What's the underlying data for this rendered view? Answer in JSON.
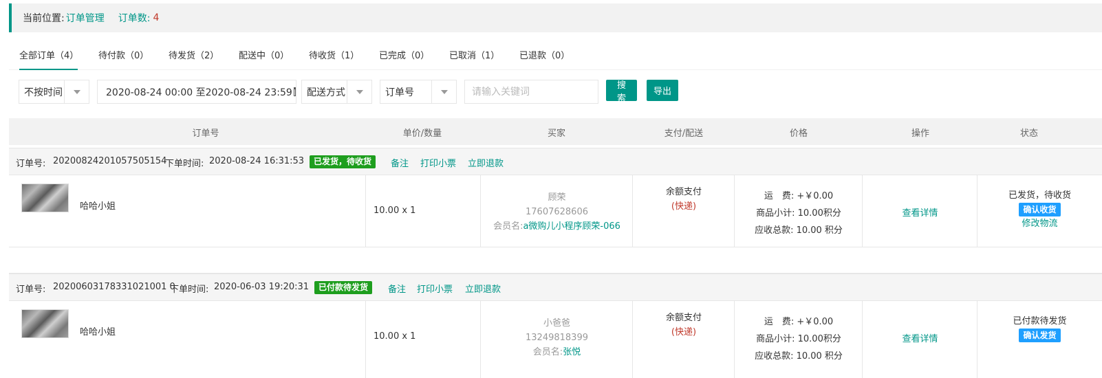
{
  "breadcrumb": {
    "label": "当前位置:",
    "current": "订单管理",
    "count_label": "订单数:",
    "count": "4"
  },
  "tabs": [
    {
      "label": "全部订单（4）"
    },
    {
      "label": "待付款（0）"
    },
    {
      "label": "待发货（2）"
    },
    {
      "label": "配送中（0）"
    },
    {
      "label": "待收货（1）"
    },
    {
      "label": "已完成（0）"
    },
    {
      "label": "已取消（1）"
    },
    {
      "label": "已退款（0）"
    }
  ],
  "filters": {
    "time_mode": "不按时间",
    "date_range": "2020-08-24 00:00 至2020-08-24 23:59",
    "delivery": "配送方式",
    "field": "订单号",
    "keyword_placeholder": "请输入关键词",
    "search_label": "搜索",
    "export_label": "导出"
  },
  "table_headers": [
    "订单号",
    "单价/数量",
    "买家",
    "支付/配送",
    "价格",
    "操作",
    "状态"
  ],
  "orders": [
    {
      "no_label": "订单号:",
      "no": "20200824201057505154",
      "time_label": "下单时间:",
      "time": "2020-08-24  16:31:53",
      "badge": "已发货，待收货",
      "link_note": "备注",
      "link_print": "打印小票",
      "link_refund": "立即退款",
      "product": "哈哈小姐",
      "price_qty": "10.00 x 1",
      "buyer_name": "顾荣",
      "buyer_phone": "17607628606",
      "member_label": "会员名:",
      "member": "a微购儿小程序顾荣-066",
      "pay": "余额支付",
      "delivery": "(快递)",
      "freight": "运　费: +￥0.00",
      "subtotal": "商品小计: 10.00积分",
      "total": "应收总款: 10.00 积分",
      "detail": "查看详情",
      "status": "已发货，待收货",
      "status_btn": "确认收货",
      "status_link": "修改物流"
    },
    {
      "no_label": "订单号:",
      "no": "20200603178331021001 0",
      "time_label": "下单时间:",
      "time": "2020-06-03  19:20:31",
      "badge": "已付款待发货",
      "link_note": "备注",
      "link_print": "打印小票",
      "link_refund": "立即退款",
      "product": "哈哈小姐",
      "price_qty": "10.00 x 1",
      "buyer_name": "小爸爸",
      "buyer_phone": "13249818399",
      "member_label": "会员名:",
      "member": "张悦",
      "pay": "余额支付",
      "delivery": "(快递)",
      "freight": "运　费: +￥0.00",
      "subtotal": "商品小计: 10.00积分",
      "total": "应收总款: 10.00 积分",
      "detail": "查看详情",
      "status": "已付款待发货",
      "status_btn": "确认发货"
    }
  ]
}
